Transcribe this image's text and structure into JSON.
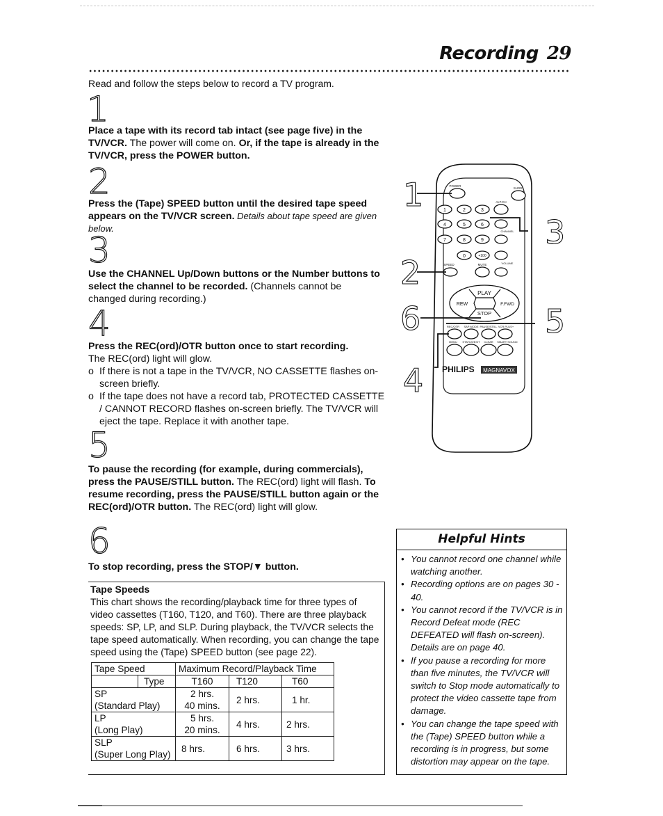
{
  "header": {
    "section_title": "Recording",
    "page_number": "29"
  },
  "intro": "Read and follow the steps below to record a TV program.",
  "steps": [
    {
      "number": "1",
      "bold_a": "Place a tape with its record tab intact (see page five) in the TV/VCR.",
      "normal_a": " The power will come on. ",
      "bold_b": "Or, if the tape is already in the TV/VCR, press the POWER button."
    },
    {
      "number": "2",
      "bold_a": "Press the (Tape) SPEED button until the desired tape speed appears on the TV/VCR screen.",
      "italic_a": " Details about tape speed are given below."
    },
    {
      "number": "3",
      "bold_a": "Use the CHANNEL Up/Down buttons or the Number buttons to select the channel to be recorded.",
      "normal_a": " (Channels cannot be changed during recording.)"
    },
    {
      "number": "4",
      "bold_a": "Press the REC(ord)/OTR button once to start recording.",
      "normal_a": "The REC(ord) light will glow.",
      "bullet_mark": "o",
      "bullets": [
        "If there is not a tape in the TV/VCR, NO CASSETTE flashes on-screen briefly.",
        "If the tape does not have a record tab, PROTECTED CASSETTE / CANNOT RECORD flashes on-screen briefly. The TV/VCR will eject the tape. Replace it with another tape."
      ]
    },
    {
      "number": "5",
      "bold_a": "To pause the recording (for example, during commercials), press the PAUSE/STILL button.",
      "normal_a": " The REC(ord) light will flash. ",
      "bold_b": "To resume recording, press the PAUSE/STILL button again or the REC(ord)/OTR button.",
      "normal_b": " The REC(ord) light will glow."
    },
    {
      "number": "6",
      "bold_a": "To stop recording, press the STOP/▼ button."
    }
  ],
  "tape_speeds": {
    "title": "Tape Speeds",
    "description": "This chart shows the recording/playback time for three types of video cassettes (T160, T120, and T60). There are three playback speeds: SP, LP, and SLP. During playback, the TV/VCR selects the tape speed automatically. When recording, you can change the tape speed using the (Tape) SPEED button (see page 22).",
    "header_speed": "Tape Speed",
    "header_type": "Type",
    "header_time": "Maximum Record/Playback Time",
    "columns": [
      "T160",
      "T120",
      "T60"
    ],
    "rows": [
      {
        "code": "SP",
        "name": "(Standard Play)",
        "t160_a": "2 hrs.",
        "t160_b": "40 mins.",
        "t120": "2 hrs.",
        "t60": "1 hr."
      },
      {
        "code": "LP",
        "name": "(Long Play)",
        "t160_a": "5 hrs.",
        "t160_b": "20 mins.",
        "t120": "4 hrs.",
        "t60": "2 hrs."
      },
      {
        "code": "SLP",
        "name": "(Super Long Play)",
        "t160_a": "8 hrs.",
        "t160_b": "",
        "t120": "6 hrs.",
        "t60": "3 hrs."
      }
    ]
  },
  "hints": {
    "title": "Helpful Hints",
    "items": [
      "You cannot record one channel while watching another.",
      "Recording options are on pages 30 - 40.",
      "You cannot record if the TV/VCR is in Record Defeat mode (REC DEFEATED will flash on-screen). Details are on page 40.",
      "If you pause a recording for more than five minutes, the TV/VCR will switch to Stop mode automatically to protect the video cassette tape from damage.",
      "You can change the tape speed with the (Tape) SPEED button while a recording is in progress, but some distortion may appear on the tape."
    ]
  },
  "remote": {
    "brand": "PHILIPS",
    "sub_brand": "MAGNAVOX",
    "callouts": [
      "1",
      "2",
      "3",
      "4",
      "5",
      "6"
    ],
    "buttons": {
      "power": "POWER",
      "sleep": "SLEEP",
      "alt_ch": "ALT.CH",
      "digits": [
        "1",
        "2",
        "3",
        "4",
        "5",
        "6",
        "7",
        "8",
        "9",
        "0"
      ],
      "plus100": "+100",
      "channel": "CHANNEL",
      "volume": "VOLUME",
      "speed": "SPEED",
      "mute": "MUTE",
      "play": "PLAY",
      "rew": "REW",
      "ffwd": "F.FWD",
      "stop": "STOP",
      "rec_otr": "REC/OTR",
      "sap_mode": "SAP MODE",
      "pause_still": "PAUSE/STILL",
      "vcr_plus": "VCR PLUS+",
      "menu": "MENU",
      "status_exit": "STATUS/EXIT",
      "clear": "CLEAR",
      "smart_sound": "SMART SOUND"
    }
  }
}
